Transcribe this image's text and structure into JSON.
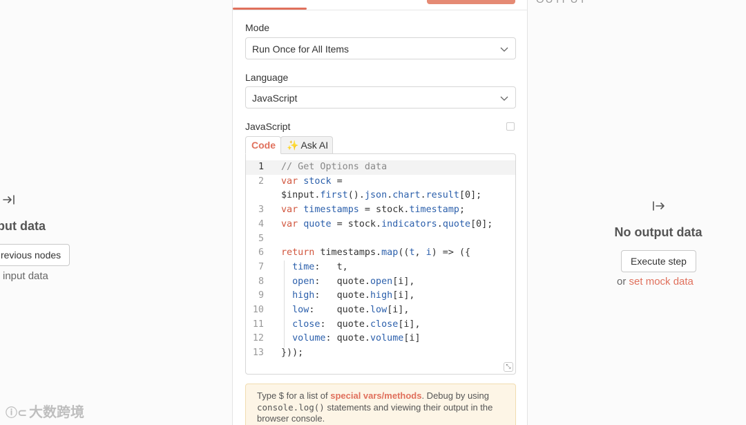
{
  "left_panel": {
    "title": "put data",
    "button_label": "revious nodes",
    "subtext": "input data",
    "icon": "arrow-into-bar-icon"
  },
  "right_panel": {
    "output_label": "OUTPUT",
    "title": "No output data",
    "execute_label": "Execute step",
    "or_text": "or ",
    "mock_link": "set mock data",
    "icon": "arrow-out-from-bar-icon"
  },
  "center": {
    "mode": {
      "label": "Mode",
      "value": "Run Once for All Items"
    },
    "language": {
      "label": "Language",
      "value": "JavaScript"
    },
    "code_label": "JavaScript",
    "tabs": {
      "code": "Code",
      "ask_ai": "Ask AI"
    },
    "accent_color": "#e0705c",
    "code_lines": [
      {
        "n": "1",
        "tokens": [
          [
            "c",
            "// Get Options data"
          ]
        ]
      },
      {
        "n": "2",
        "tokens": [
          [
            "k",
            "var "
          ],
          [
            "v",
            "stock"
          ],
          [
            "p",
            " ="
          ]
        ]
      },
      {
        "n": "",
        "tokens": [
          [
            "p",
            "$input."
          ],
          [
            "v",
            "first"
          ],
          [
            "p",
            "()."
          ],
          [
            "v",
            "json"
          ],
          [
            "p",
            "."
          ],
          [
            "v",
            "chart"
          ],
          [
            "p",
            "."
          ],
          [
            "v",
            "result"
          ],
          [
            "p",
            "[0];"
          ]
        ]
      },
      {
        "n": "3",
        "tokens": [
          [
            "k",
            "var "
          ],
          [
            "v",
            "timestamps"
          ],
          [
            "p",
            " = stock."
          ],
          [
            "v",
            "timestamp"
          ],
          [
            "p",
            ";"
          ]
        ]
      },
      {
        "n": "4",
        "tokens": [
          [
            "k",
            "var "
          ],
          [
            "v",
            "quote"
          ],
          [
            "p",
            " = stock."
          ],
          [
            "v",
            "indicators"
          ],
          [
            "p",
            "."
          ],
          [
            "v",
            "quote"
          ],
          [
            "p",
            "[0];"
          ]
        ]
      },
      {
        "n": "5",
        "tokens": []
      },
      {
        "n": "6",
        "tokens": [
          [
            "k",
            "return "
          ],
          [
            "p",
            "timestamps."
          ],
          [
            "v",
            "map"
          ],
          [
            "p",
            "(("
          ],
          [
            "v",
            "t"
          ],
          [
            "p",
            ", "
          ],
          [
            "v",
            "i"
          ],
          [
            "p",
            ") => ({"
          ]
        ]
      },
      {
        "n": "7",
        "tokens": [
          [
            "p",
            "  "
          ],
          [
            "v",
            "time"
          ],
          [
            "p",
            ":   t,"
          ]
        ]
      },
      {
        "n": "8",
        "tokens": [
          [
            "p",
            "  "
          ],
          [
            "v",
            "open"
          ],
          [
            "p",
            ":   quote."
          ],
          [
            "v",
            "open"
          ],
          [
            "p",
            "[i],"
          ]
        ]
      },
      {
        "n": "9",
        "tokens": [
          [
            "p",
            "  "
          ],
          [
            "v",
            "high"
          ],
          [
            "p",
            ":   quote."
          ],
          [
            "v",
            "high"
          ],
          [
            "p",
            "[i],"
          ]
        ]
      },
      {
        "n": "10",
        "tokens": [
          [
            "p",
            "  "
          ],
          [
            "v",
            "low"
          ],
          [
            "p",
            ":    quote."
          ],
          [
            "v",
            "low"
          ],
          [
            "p",
            "[i],"
          ]
        ]
      },
      {
        "n": "11",
        "tokens": [
          [
            "p",
            "  "
          ],
          [
            "v",
            "close"
          ],
          [
            "p",
            ":  quote."
          ],
          [
            "v",
            "close"
          ],
          [
            "p",
            "[i],"
          ]
        ]
      },
      {
        "n": "12",
        "tokens": [
          [
            "p",
            "  "
          ],
          [
            "v",
            "volume"
          ],
          [
            "p",
            ": quote."
          ],
          [
            "v",
            "volume"
          ],
          [
            "p",
            "[i]"
          ]
        ]
      },
      {
        "n": "13",
        "tokens": [
          [
            "p",
            "}));"
          ]
        ]
      }
    ],
    "hint": {
      "prefix": "Type $ for a list of ",
      "link": "special vars/methods",
      "middle": ". Debug by using ",
      "code": "console.log()",
      "suffix": " statements and viewing their output in the browser console."
    }
  },
  "watermark": {
    "text": "大数跨境"
  }
}
